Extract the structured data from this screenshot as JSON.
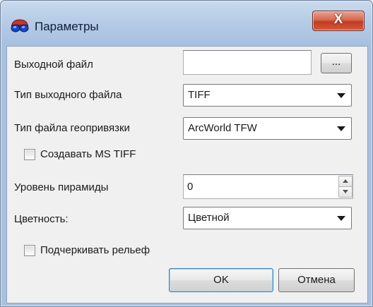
{
  "window": {
    "title": "Параметры",
    "close_label": "X",
    "icon": "red-blue-3d-glasses-icon"
  },
  "form": {
    "output_file_label": "Выходной файл",
    "output_file_value": "",
    "browse_label": "...",
    "output_type_label": "Тип выходного файла",
    "output_type_value": "TIFF",
    "georef_type_label": "Тип файла геопривязки",
    "georef_type_value": "ArcWorld TFW",
    "ms_tiff_label": "Создавать MS TIFF",
    "ms_tiff_checked": false,
    "pyramid_label": "Уровень пирамиды",
    "pyramid_value": "0",
    "color_label": "Цветность:",
    "color_value": "Цветной",
    "relief_label": "Подчеркивать рельеф",
    "relief_checked": false
  },
  "buttons": {
    "ok": "OK",
    "cancel": "Отмена"
  },
  "colors": {
    "close_button": "#c23b22",
    "default_button_border": "#3c7fb1"
  }
}
